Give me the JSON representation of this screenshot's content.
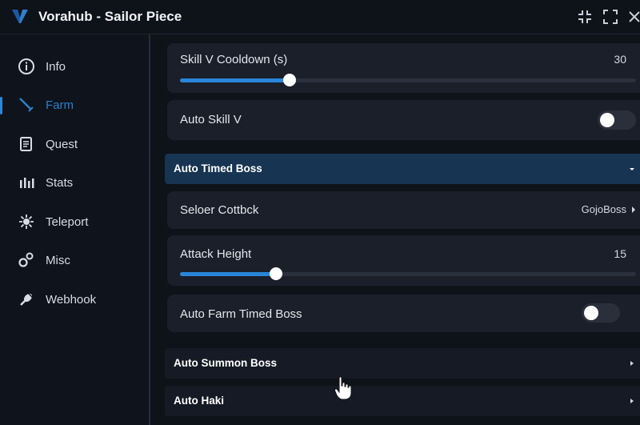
{
  "window": {
    "title": "Vorahub - Sailor Piece",
    "accent": "#2a86d9"
  },
  "sidebar": {
    "items": [
      {
        "label": "Info",
        "icon": "info-icon"
      },
      {
        "label": "Farm",
        "icon": "sword-icon",
        "active": true
      },
      {
        "label": "Quest",
        "icon": "scroll-icon"
      },
      {
        "label": "Stats",
        "icon": "bars-icon"
      },
      {
        "label": "Teleport",
        "icon": "teleport-icon"
      },
      {
        "label": "Misc",
        "icon": "gears-icon"
      },
      {
        "label": "Webhook",
        "icon": "link-icon"
      }
    ]
  },
  "content": {
    "skill_v_cooldown": {
      "label": "Skill V Cooldown (s)",
      "value": "30",
      "fraction": 0.24
    },
    "auto_skill_v": {
      "label": "Auto Skill V",
      "on": false
    },
    "section_timed_boss": {
      "title": "Auto Timed Boss",
      "expanded": true
    },
    "select_boss": {
      "label": "Seloer Cottbck",
      "value": "GojoBoss"
    },
    "attack_height": {
      "label": "Attack Height",
      "value": "15",
      "fraction": 0.21
    },
    "auto_farm_timed_boss": {
      "label": "Auto Farm Timed Boss",
      "on": false
    },
    "section_summon_boss": {
      "title": "Auto Summon Boss",
      "expanded": false
    },
    "section_auto_haki": {
      "title": "Auto Haki",
      "expanded": false
    }
  }
}
